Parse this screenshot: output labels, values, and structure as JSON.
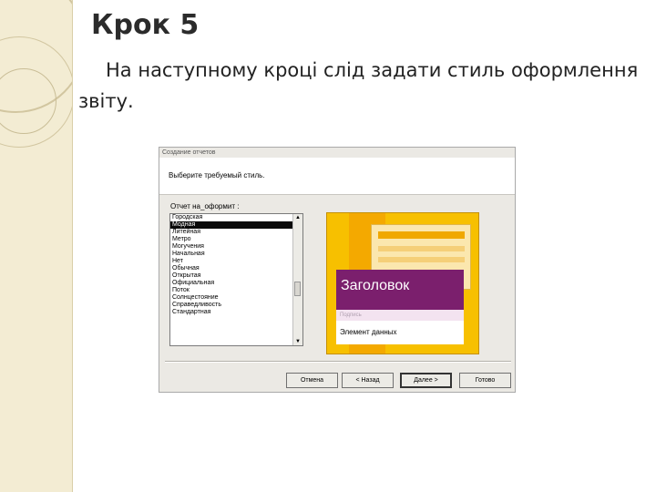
{
  "slide": {
    "title": "Крок 5",
    "text": "На наступному кроці слід задати стиль оформлення звіту."
  },
  "dialog": {
    "title": "Создание отчетов",
    "prompt": "Выберите требуемый стиль.",
    "list_label": "Отчет на_оформит :",
    "styles": [
      "Городская",
      "Модная",
      "Литейная",
      "Метро",
      "Могучения",
      "Начальная",
      "Нет",
      "Обычная",
      "Открытая",
      "Официальная",
      "Поток",
      "Солнцестояние",
      "Справедливость",
      "Стандартная"
    ],
    "selected_style": "Модная",
    "preview": {
      "title_text": "Заголовок",
      "caption_text": "Подпись",
      "element_text": "Элемент данных"
    },
    "buttons": {
      "cancel": "Отмена",
      "back": "< Назад",
      "next": "Далее >",
      "finish": "Готово"
    }
  }
}
